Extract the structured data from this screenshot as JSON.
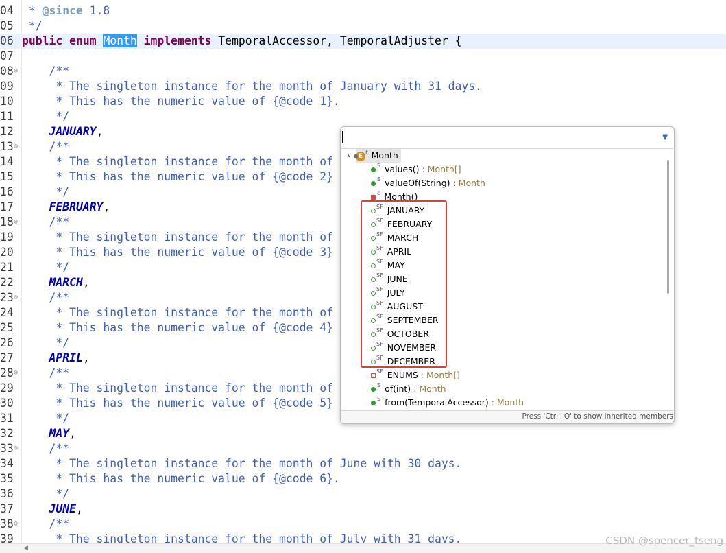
{
  "editor": {
    "lines": [
      {
        "n": "04",
        "fold": "",
        "tokens": [
          {
            "t": " * ",
            "c": "comment"
          },
          {
            "t": "@since",
            "c": "tag"
          },
          {
            "t": " 1.8",
            "c": "comment"
          }
        ]
      },
      {
        "n": "05",
        "fold": "",
        "tokens": [
          {
            "t": " */",
            "c": "comment"
          }
        ]
      },
      {
        "n": "06",
        "fold": "",
        "current": true,
        "tokens": [
          {
            "t": "public",
            "c": "keyword"
          },
          {
            "t": " ",
            "c": "plain"
          },
          {
            "t": "enum",
            "c": "keyword"
          },
          {
            "t": " ",
            "c": "plain"
          },
          {
            "t": "Month",
            "c": "hl"
          },
          {
            "t": " ",
            "c": "plain"
          },
          {
            "t": "implements",
            "c": "keyword"
          },
          {
            "t": " TemporalAccessor, TemporalAdjuster {",
            "c": "plain"
          }
        ]
      },
      {
        "n": "07",
        "fold": "",
        "tokens": []
      },
      {
        "n": "08",
        "fold": "⊖",
        "tokens": [
          {
            "t": "    /**",
            "c": "comment"
          }
        ]
      },
      {
        "n": "09",
        "fold": "",
        "tokens": [
          {
            "t": "     * The singleton instance for the month of January with 31 days.",
            "c": "comment"
          }
        ]
      },
      {
        "n": "10",
        "fold": "",
        "tokens": [
          {
            "t": "     * This has the numeric value of {@code 1}.",
            "c": "comment"
          }
        ]
      },
      {
        "n": "11",
        "fold": "",
        "tokens": [
          {
            "t": "     */",
            "c": "comment"
          }
        ]
      },
      {
        "n": "12",
        "fold": "",
        "tokens": [
          {
            "t": "    ",
            "c": "plain"
          },
          {
            "t": "JANUARY",
            "c": "const"
          },
          {
            "t": ",",
            "c": "plain"
          }
        ]
      },
      {
        "n": "13",
        "fold": "⊖",
        "tokens": [
          {
            "t": "    /**",
            "c": "comment"
          }
        ]
      },
      {
        "n": "14",
        "fold": "",
        "tokens": [
          {
            "t": "     * The singleton instance for the month of",
            "c": "comment"
          }
        ]
      },
      {
        "n": "15",
        "fold": "",
        "tokens": [
          {
            "t": "     * This has the numeric value of {@code 2}",
            "c": "comment"
          }
        ]
      },
      {
        "n": "16",
        "fold": "",
        "tokens": [
          {
            "t": "     */",
            "c": "comment"
          }
        ]
      },
      {
        "n": "17",
        "fold": "",
        "tokens": [
          {
            "t": "    ",
            "c": "plain"
          },
          {
            "t": "FEBRUARY",
            "c": "const"
          },
          {
            "t": ",",
            "c": "plain"
          }
        ]
      },
      {
        "n": "18",
        "fold": "⊖",
        "tokens": [
          {
            "t": "    /**",
            "c": "comment"
          }
        ]
      },
      {
        "n": "19",
        "fold": "",
        "tokens": [
          {
            "t": "     * The singleton instance for the month of",
            "c": "comment"
          }
        ]
      },
      {
        "n": "20",
        "fold": "",
        "tokens": [
          {
            "t": "     * This has the numeric value of {@code 3}",
            "c": "comment"
          }
        ]
      },
      {
        "n": "21",
        "fold": "",
        "tokens": [
          {
            "t": "     */",
            "c": "comment"
          }
        ]
      },
      {
        "n": "22",
        "fold": "",
        "tokens": [
          {
            "t": "    ",
            "c": "plain"
          },
          {
            "t": "MARCH",
            "c": "const"
          },
          {
            "t": ",",
            "c": "plain"
          }
        ]
      },
      {
        "n": "23",
        "fold": "⊖",
        "tokens": [
          {
            "t": "    /**",
            "c": "comment"
          }
        ]
      },
      {
        "n": "24",
        "fold": "",
        "tokens": [
          {
            "t": "     * The singleton instance for the month of",
            "c": "comment"
          }
        ]
      },
      {
        "n": "25",
        "fold": "",
        "tokens": [
          {
            "t": "     * This has the numeric value of {@code 4}",
            "c": "comment"
          }
        ]
      },
      {
        "n": "26",
        "fold": "",
        "tokens": [
          {
            "t": "     */",
            "c": "comment"
          }
        ]
      },
      {
        "n": "27",
        "fold": "",
        "tokens": [
          {
            "t": "    ",
            "c": "plain"
          },
          {
            "t": "APRIL",
            "c": "const"
          },
          {
            "t": ",",
            "c": "plain"
          }
        ]
      },
      {
        "n": "28",
        "fold": "⊖",
        "tokens": [
          {
            "t": "    /**",
            "c": "comment"
          }
        ]
      },
      {
        "n": "29",
        "fold": "",
        "tokens": [
          {
            "t": "     * The singleton instance for the month of",
            "c": "comment"
          }
        ]
      },
      {
        "n": "30",
        "fold": "",
        "tokens": [
          {
            "t": "     * This has the numeric value of {@code 5}",
            "c": "comment"
          }
        ]
      },
      {
        "n": "31",
        "fold": "",
        "tokens": [
          {
            "t": "     */",
            "c": "comment"
          }
        ]
      },
      {
        "n": "32",
        "fold": "",
        "tokens": [
          {
            "t": "    ",
            "c": "plain"
          },
          {
            "t": "MAY",
            "c": "const"
          },
          {
            "t": ",",
            "c": "plain"
          }
        ]
      },
      {
        "n": "33",
        "fold": "⊖",
        "tokens": [
          {
            "t": "    /**",
            "c": "comment"
          }
        ]
      },
      {
        "n": "34",
        "fold": "",
        "tokens": [
          {
            "t": "     * The singleton instance for the month of June with 30 days.",
            "c": "comment"
          }
        ]
      },
      {
        "n": "35",
        "fold": "",
        "tokens": [
          {
            "t": "     * This has the numeric value of {@code 6}.",
            "c": "comment"
          }
        ]
      },
      {
        "n": "36",
        "fold": "",
        "tokens": [
          {
            "t": "     */",
            "c": "comment"
          }
        ]
      },
      {
        "n": "37",
        "fold": "",
        "tokens": [
          {
            "t": "    ",
            "c": "plain"
          },
          {
            "t": "JUNE",
            "c": "const"
          },
          {
            "t": ",",
            "c": "plain"
          }
        ]
      },
      {
        "n": "38",
        "fold": "⊖",
        "tokens": [
          {
            "t": "    /**",
            "c": "comment"
          }
        ]
      },
      {
        "n": "39",
        "fold": "",
        "tokens": [
          {
            "t": "     * The singleton instance for the month of July with 31 days.",
            "c": "comment"
          }
        ]
      }
    ]
  },
  "outline": {
    "filter_value": "",
    "root": {
      "label": "Month",
      "mods": "F",
      "icon": "enum-icon",
      "icon_letter": "E"
    },
    "members": [
      {
        "kind": "method",
        "mods": "S",
        "label": "values()",
        "type": " : Month[]"
      },
      {
        "kind": "method",
        "mods": "S",
        "label": "valueOf(String)",
        "type": " : Month"
      },
      {
        "kind": "ctor",
        "mods": "c",
        "label": "Month()",
        "type": ""
      },
      {
        "kind": "field",
        "mods": "SF",
        "label": "JANUARY",
        "type": ""
      },
      {
        "kind": "field",
        "mods": "SF",
        "label": "FEBRUARY",
        "type": ""
      },
      {
        "kind": "field",
        "mods": "SF",
        "label": "MARCH",
        "type": ""
      },
      {
        "kind": "field",
        "mods": "SF",
        "label": "APRIL",
        "type": ""
      },
      {
        "kind": "field",
        "mods": "SF",
        "label": "MAY",
        "type": ""
      },
      {
        "kind": "field",
        "mods": "SF",
        "label": "JUNE",
        "type": ""
      },
      {
        "kind": "field",
        "mods": "SF",
        "label": "JULY",
        "type": ""
      },
      {
        "kind": "field",
        "mods": "SF",
        "label": "AUGUST",
        "type": ""
      },
      {
        "kind": "field",
        "mods": "SF",
        "label": "SEPTEMBER",
        "type": ""
      },
      {
        "kind": "field",
        "mods": "SF",
        "label": "OCTOBER",
        "type": ""
      },
      {
        "kind": "field",
        "mods": "SF",
        "label": "NOVEMBER",
        "type": ""
      },
      {
        "kind": "field",
        "mods": "SF",
        "label": "DECEMBER",
        "type": ""
      },
      {
        "kind": "private",
        "mods": "SF",
        "label": "ENUMS",
        "type": " : Month[]"
      },
      {
        "kind": "method",
        "mods": "S",
        "label": "of(int)",
        "type": " : Month"
      },
      {
        "kind": "method",
        "mods": "S",
        "label": "from(TemporalAccessor)",
        "type": " : Month"
      }
    ],
    "status": "Press 'Ctrl+O' to show inherited members"
  },
  "watermark": "CSDN @spencer_tseng",
  "colors": {
    "highlight_box": "#e23b3b",
    "current_line": "#e8f2fe",
    "selection": "#3399ff"
  }
}
